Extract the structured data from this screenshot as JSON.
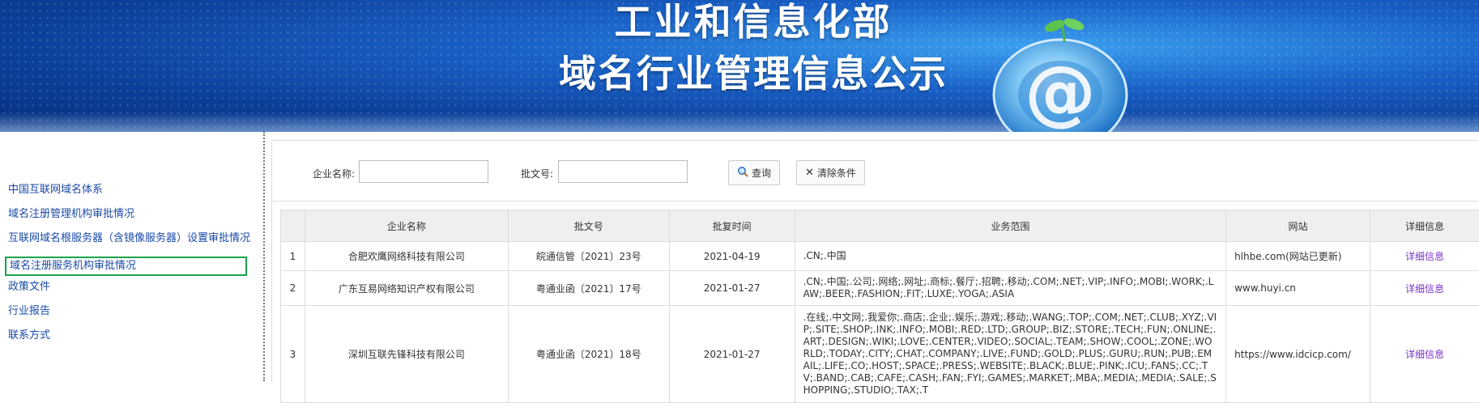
{
  "banner": {
    "title_line1": "工业和信息化部",
    "title_line2": "域名行业管理信息公示"
  },
  "sidebar": {
    "items": [
      {
        "label": "中国互联网域名体系"
      },
      {
        "label": "域名注册管理机构审批情况"
      },
      {
        "label": "互联网域名根服务器（含镜像服务器）设置审批情况"
      },
      {
        "label": "域名注册服务机构审批情况"
      },
      {
        "label": "政策文件"
      },
      {
        "label": "行业报告"
      },
      {
        "label": "联系方式"
      }
    ]
  },
  "filter": {
    "company_label": "企业名称:",
    "company_value": "",
    "approval_label": "批文号:",
    "approval_value": "",
    "search_label": "查询",
    "clear_label": "清除条件"
  },
  "table": {
    "headers": [
      "",
      "企业名称",
      "批文号",
      "批复时间",
      "业务范围",
      "网站",
      "详细信息"
    ],
    "rows": [
      {
        "no": "1",
        "company": "合肥欢鹰网络科技有限公司",
        "approval": "皖通信管〔2021〕23号",
        "date": "2021-04-19",
        "scope": ".CN;.中国",
        "site": "hlhbe.com(网站已更新)",
        "detail": "详细信息"
      },
      {
        "no": "2",
        "company": "广东互易网络知识产权有限公司",
        "approval": "粤通业函〔2021〕17号",
        "date": "2021-01-27",
        "scope": ".CN;.中国;.公司;.网络;.网址;.商标;.餐厅;.招聘;.移动;.COM;.NET;.VIP;.INFO;.MOBI;.WORK;.LAW;.BEER;.FASHION;.FIT;.LUXE;.YOGA;.ASIA",
        "site": "www.huyi.cn",
        "detail": "详细信息"
      },
      {
        "no": "3",
        "company": "深圳互联先锋科技有限公司",
        "approval": "粤通业函〔2021〕18号",
        "date": "2021-01-27",
        "scope": ".在线;.中文网;.我爱你;.商店;.企业;.娱乐;.游戏;.移动;.WANG;.TOP;.COM;.NET;.CLUB;.XYZ;.VIP;.SITE;.SHOP;.INK;.INFO;.MOBI;.RED;.LTD;.GROUP;.BIZ;.STORE;.TECH;.FUN;.ONLINE;.ART;.DESIGN;.WIKI;.LOVE;.CENTER;.VIDEO;.SOCIAL;.TEAM;.SHOW;.COOL;.ZONE;.WORLD;.TODAY;.CITY;.CHAT;.COMPANY;.LIVE;.FUND;.GOLD;.PLUS;.GURU;.RUN;.PUB;.EMAIL;.LIFE;.CO;.HOST;.SPACE;.PRESS;.WEBSITE;.BLACK;.BLUE;.PINK;.ICU;.FANS;.CC;.TV;.BAND;.CAB;.CAFE;.CASH;.FAN;.FYI;.GAMES;.MARKET;.MBA;.MEDIA;.MEDIA;.SALE;.SHOPPING;.STUDIO;.TAX;.T",
        "site": "https://www.idcicp.com/",
        "detail": "详细信息"
      }
    ]
  },
  "colors": {
    "banner_blue": "#0c3f9a",
    "link_blue": "#1a4aa8",
    "active_border": "#19a34a",
    "detail_purple": "#7a33c7"
  }
}
